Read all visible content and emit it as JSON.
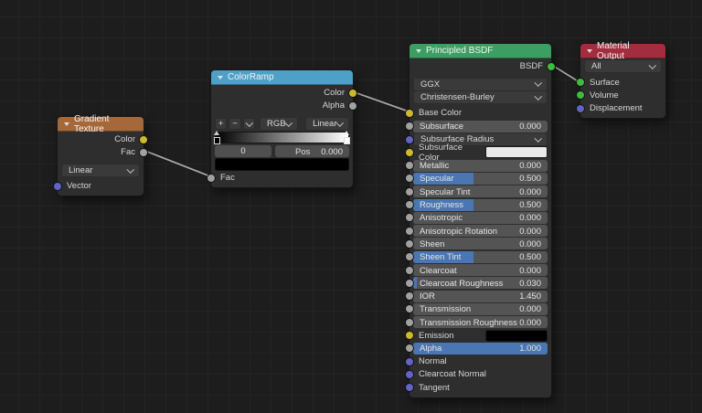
{
  "editor": {
    "background": "#1d1d1d",
    "grid_line": "#242424",
    "wire_color": "#a6a6a6",
    "slider_fill_color": "#4a76b4",
    "socket_colors": {
      "color": "#cdb929",
      "value": "#a1a1a1",
      "shader": "#3fbc3f",
      "vector": "#6363c7"
    }
  },
  "nodes": {
    "gradient_texture": {
      "title": "Gradient Texture",
      "header_color": "#a5683a",
      "outputs": [
        {
          "label": "Color"
        },
        {
          "label": "Fac"
        }
      ],
      "type_dropdown": "Linear",
      "inputs": [
        {
          "label": "Vector"
        }
      ]
    },
    "color_ramp": {
      "title": "ColorRamp",
      "header_color": "#4ea0c9",
      "outputs": [
        {
          "label": "Color"
        },
        {
          "label": "Alpha"
        }
      ],
      "tools": {
        "add": "+",
        "remove": "−"
      },
      "color_mode": "RGB",
      "interpolation": "Linear",
      "active_index": "0",
      "pos_label": "Pos",
      "pos_value": "0.000",
      "stops": [
        {
          "color": "#000000"
        },
        {
          "color": "#ffffff"
        }
      ],
      "selected_color": "#000000",
      "inputs": [
        {
          "label": "Fac"
        }
      ]
    },
    "principled_bsdf": {
      "title": "Principled BSDF",
      "header_color": "#3d9e63",
      "output_label": "BSDF",
      "distribution": "GGX",
      "subsurface_method": "Christensen-Burley",
      "rows": [
        {
          "label": "Base Color"
        },
        {
          "label": "Subsurface",
          "value": "0.000",
          "fill_pct": "0%"
        },
        {
          "label": "Subsurface Radius"
        },
        {
          "label": "Subsurface Color",
          "swatch": "#e9e9e9"
        },
        {
          "label": "Metallic",
          "value": "0.000",
          "fill_pct": "0%"
        },
        {
          "label": "Specular",
          "value": "0.500",
          "fill_pct": "45%"
        },
        {
          "label": "Specular Tint",
          "value": "0.000",
          "fill_pct": "0%"
        },
        {
          "label": "Roughness",
          "value": "0.500",
          "fill_pct": "45%"
        },
        {
          "label": "Anisotropic",
          "value": "0.000",
          "fill_pct": "0%"
        },
        {
          "label": "Anisotropic Rotation",
          "value": "0.000",
          "fill_pct": "0%"
        },
        {
          "label": "Sheen",
          "value": "0.000",
          "fill_pct": "0%"
        },
        {
          "label": "Sheen Tint",
          "value": "0.500",
          "fill_pct": "45%"
        },
        {
          "label": "Clearcoat",
          "value": "0.000",
          "fill_pct": "0%"
        },
        {
          "label": "Clearcoat Roughness",
          "value": "0.030",
          "fill_pct": "3%"
        },
        {
          "label": "IOR",
          "value": "1.450",
          "fill_pct": "0%"
        },
        {
          "label": "Transmission",
          "value": "0.000",
          "fill_pct": "0%"
        },
        {
          "label": "Transmission Roughness",
          "value": "0.000",
          "fill_pct": "0%"
        },
        {
          "label": "Emission",
          "swatch": "#000000"
        },
        {
          "label": "Alpha",
          "value": "1.000",
          "fill_pct": "100%"
        },
        {
          "label": "Normal"
        },
        {
          "label": "Clearcoat Normal"
        },
        {
          "label": "Tangent"
        }
      ]
    },
    "material_output": {
      "title": "Material Output",
      "header_color": "#a12d3e",
      "target_dropdown": "All",
      "inputs": [
        {
          "label": "Surface"
        },
        {
          "label": "Volume"
        },
        {
          "label": "Displacement"
        }
      ]
    }
  }
}
